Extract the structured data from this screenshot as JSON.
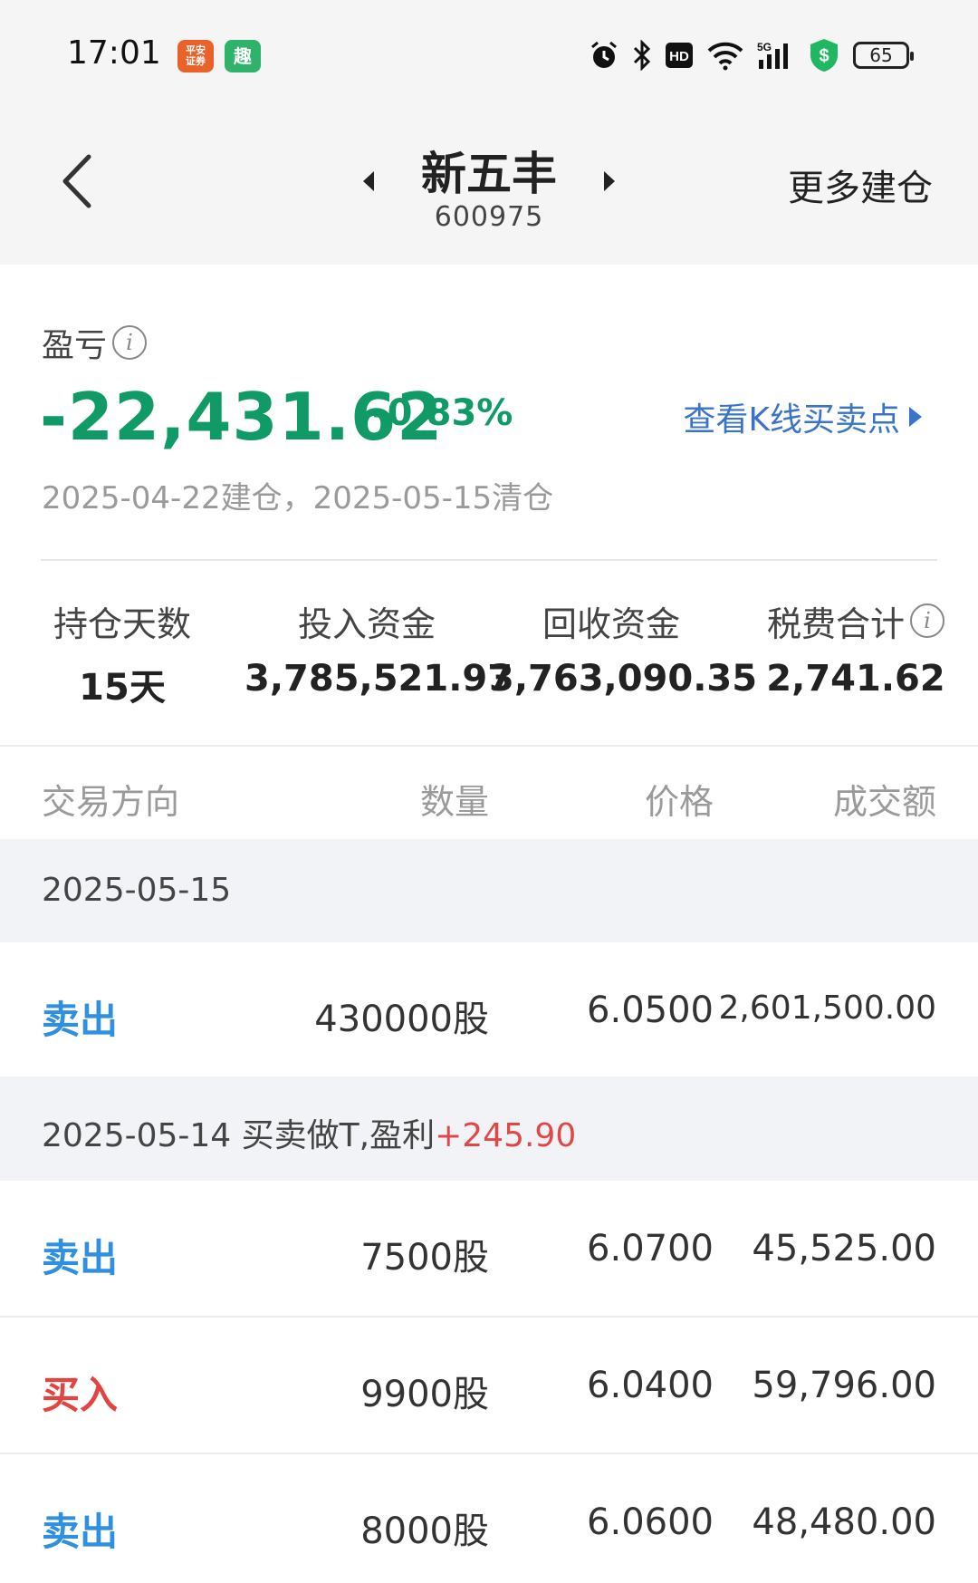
{
  "status_bar": {
    "time": "17:01",
    "app1_label": "平安证券",
    "app2_label": "趣",
    "battery": "65",
    "icons": [
      "alarm-icon",
      "bluetooth-icon",
      "hd-icon",
      "wifi-icon",
      "signal-5g-icon",
      "shield-dollar-icon",
      "battery-icon"
    ]
  },
  "nav": {
    "stock_name": "新五丰",
    "stock_code": "600975",
    "more_label": "更多建仓"
  },
  "summary": {
    "pl_label": "盈亏",
    "pl_value": "-22,431.62",
    "pl_percent": "-0.83%",
    "kline_link": "查看K线买卖点",
    "dates": "2025-04-22建仓，2025-05-15清仓"
  },
  "stats": {
    "hold_days_label": "持仓天数",
    "hold_days_value": "15天",
    "invest_label": "投入资金",
    "invest_value": "3,785,521.97",
    "recover_label": "回收资金",
    "recover_value": "3,763,090.35",
    "fee_label": "税费合计",
    "fee_value": "2,741.62"
  },
  "table": {
    "headers": {
      "direction": "交易方向",
      "quantity": "数量",
      "price": "价格",
      "amount": "成交额"
    },
    "sections": [
      {
        "date": "2025-05-15",
        "note": "",
        "profit": "",
        "rows": [
          {
            "direction": "卖出",
            "type": "sell",
            "quantity": "430000股",
            "price": "6.0500",
            "amount": "2,601,500.00"
          }
        ]
      },
      {
        "date": "2025-05-14",
        "note": " 买卖做T,盈利",
        "profit": "+245.90",
        "rows": [
          {
            "direction": "卖出",
            "type": "sell",
            "quantity": "7500股",
            "price": "6.0700",
            "amount": "45,525.00"
          },
          {
            "direction": "买入",
            "type": "buy",
            "quantity": "9900股",
            "price": "6.0400",
            "amount": "59,796.00"
          },
          {
            "direction": "卖出",
            "type": "sell",
            "quantity": "8000股",
            "price": "6.0600",
            "amount": "48,480.00"
          }
        ]
      }
    ]
  },
  "colors": {
    "loss_green": "#0f9a66",
    "link_blue": "#3a74c8",
    "sell_blue": "#2f8fe0",
    "buy_red": "#e5433f",
    "section_bg": "#f2f3f7"
  }
}
